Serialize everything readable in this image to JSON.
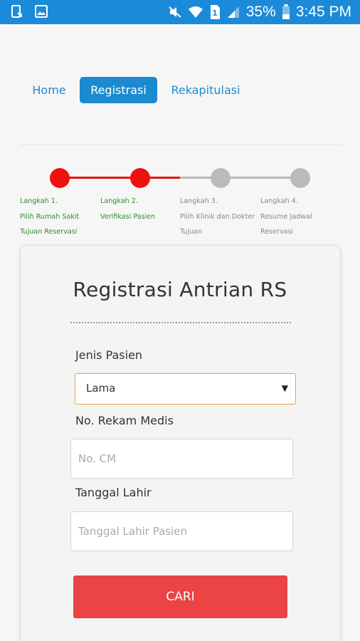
{
  "status_bar": {
    "battery_percent": "35%",
    "time": "3:45 PM",
    "icons": [
      "phone-sync-icon",
      "image-icon",
      "mute-icon",
      "wifi-icon",
      "sim-1-icon",
      "signal-icon",
      "battery-icon"
    ]
  },
  "nav": {
    "home": "Home",
    "registrasi": "Registrasi",
    "rekapitulasi": "Rekapitulasi",
    "active": "Registrasi"
  },
  "steps": [
    {
      "label": "Langkah 1.\nPilih Rumah Sakit\nTujuan Reservasi",
      "state": "active"
    },
    {
      "label": "Langkah 2.\nVerifikasi Pasien",
      "state": "active"
    },
    {
      "label": "Langkah 3.\nPilih Klinik dan Dokter\nTujuan",
      "state": "idle"
    },
    {
      "label": "Langkah 4.\nResume Jadwal\nReservasi",
      "state": "idle"
    }
  ],
  "form": {
    "title": "Registrasi Antrian RS",
    "jenis_label": "Jenis Pasien",
    "jenis_value": "Lama",
    "rm_label": "No. Rekam Medis",
    "rm_placeholder": "No. CM",
    "tgl_label": "Tanggal Lahir",
    "tgl_placeholder": "Tanggal Lahir Pasien",
    "submit_label": "CARI"
  },
  "colors": {
    "primary": "#1a8bd0",
    "step_active": "#ee1111",
    "step_idle": "#bbbbbb",
    "step_label_active": "#2e8b2e",
    "button": "#ea4444",
    "select_border": "#e8a050"
  }
}
